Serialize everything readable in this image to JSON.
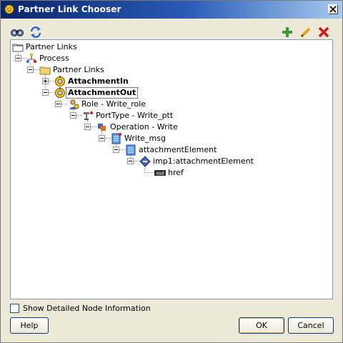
{
  "window": {
    "title": "Partner Link Chooser"
  },
  "toolbar": {
    "left": [
      {
        "name": "search-icon"
      },
      {
        "name": "refresh-icon"
      }
    ],
    "right": [
      {
        "name": "add-icon"
      },
      {
        "name": "edit-icon"
      },
      {
        "name": "delete-icon"
      }
    ]
  },
  "tree": {
    "root": "Partner Links",
    "process": "Process",
    "partner_links": "Partner Links",
    "attachment_in": "AttachmentIn",
    "attachment_out": "AttachmentOut",
    "role": "Role - Write_role",
    "port_type": "PortType - Write_ptt",
    "operation": "Operation - Write",
    "message": "Write_msg",
    "element": "attachmentElement",
    "imp_element": "imp1:attachmentElement",
    "href": "href",
    "href_type_badge": "xsd"
  },
  "options": {
    "show_detailed_label": "Show Detailed Node Information",
    "show_detailed_checked": false
  },
  "buttons": {
    "help": "Help",
    "ok": "OK",
    "cancel": "Cancel"
  },
  "colors": {
    "title_bar_start": "#0a246a",
    "title_bar_end": "#a6caf0",
    "dialog_bg": "#ece9d8",
    "delete_red": "#d11a1a",
    "add_green": "#3a9a3a"
  }
}
